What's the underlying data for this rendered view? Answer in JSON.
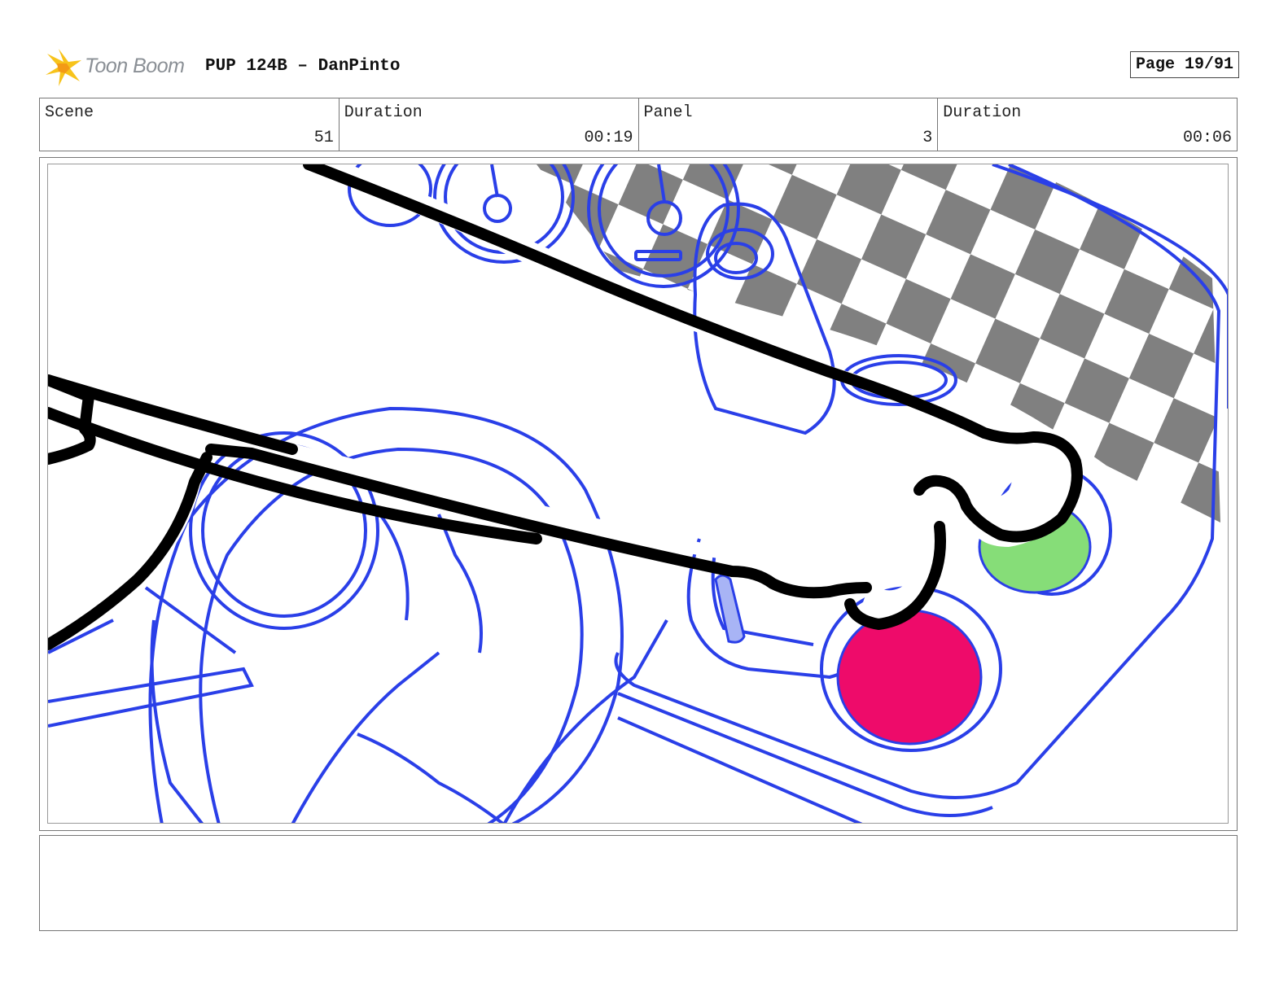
{
  "header": {
    "logo_text": "Toon Boom",
    "project_title": "PUP 124B – DanPinto",
    "page_label": "Page 19/91"
  },
  "info": {
    "scene_label": "Scene",
    "scene_value": "51",
    "scene_duration_label": "Duration",
    "scene_duration_value": "00:19",
    "panel_label": "Panel",
    "panel_value": "3",
    "panel_duration_label": "Duration",
    "panel_duration_value": "00:06"
  },
  "panel_image": {
    "icon": "storyboard-drawing-paw-pressing-button",
    "colors": {
      "line": "#2a3fe8",
      "ink": "#000000",
      "checker_dark": "#808080",
      "green_button": "#86dd78",
      "red_button": "#ee0b6a",
      "lever": "#a8b4f5"
    }
  },
  "notes": {
    "text": ""
  }
}
